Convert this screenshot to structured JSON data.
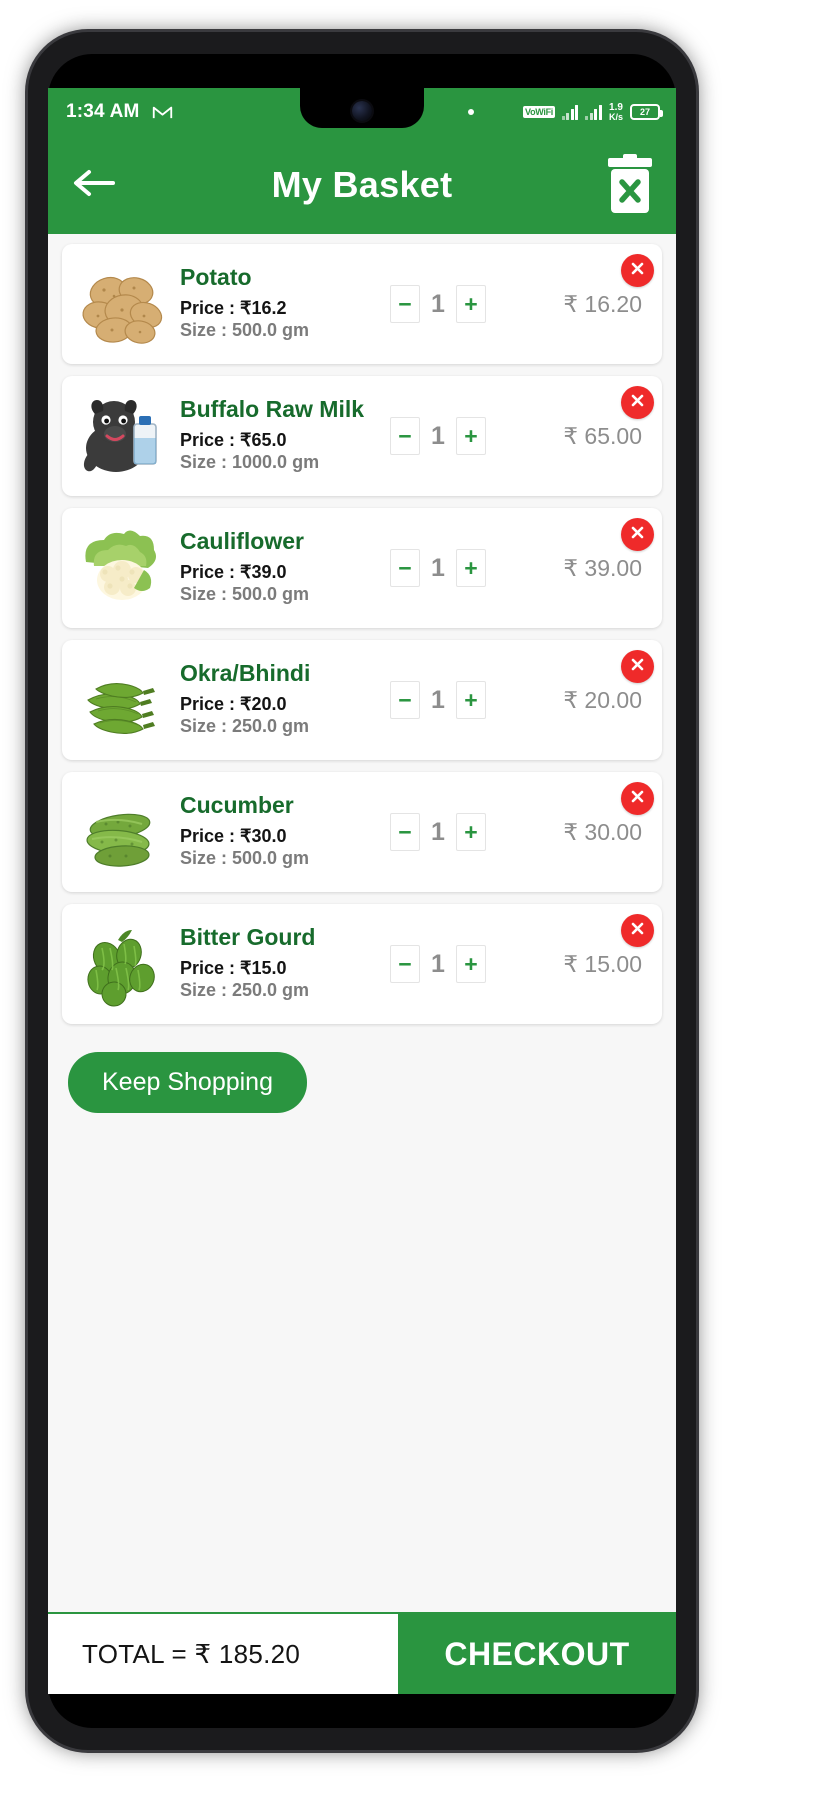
{
  "status_bar": {
    "clock": "1:34 AM",
    "mail_icon": "gmail-icon",
    "dot_icon": "notification-dot-icon",
    "vowifi_label": "VoWiFi",
    "data_speed_value": "1.9",
    "data_speed_unit": "K/s",
    "battery_percent": "27"
  },
  "app_bar": {
    "back_icon": "back-arrow-icon",
    "title": "My Basket",
    "clear_cart_icon": "trash-delete-icon"
  },
  "colors": {
    "brand_green": "#2a9540",
    "title_green": "#176b2c",
    "delete_red": "#ef2a2a",
    "muted_gray": "#8d8d8d",
    "page_bg": "#f7f7f7"
  },
  "stepper": {
    "decrement_label": "−",
    "increment_label": "+"
  },
  "labels": {
    "price_prefix": "Price : ",
    "size_prefix": "Size : ",
    "rupee": "₹"
  },
  "cart_items": [
    {
      "name": "Potato",
      "icon": "potato-image",
      "price": "Price : ₹16.2",
      "size": "Size : 500.0 gm",
      "qty": "1",
      "line_total": "₹ 16.20",
      "delete_icon": "remove-item-icon"
    },
    {
      "name": "Buffalo Raw Milk",
      "icon": "buffalo-milk-image",
      "price": "Price : ₹65.0",
      "size": "Size : 1000.0 gm",
      "qty": "1",
      "line_total": "₹ 65.00",
      "delete_icon": "remove-item-icon"
    },
    {
      "name": "Cauliflower",
      "icon": "cauliflower-image",
      "price": "Price : ₹39.0",
      "size": "Size : 500.0 gm",
      "qty": "1",
      "line_total": "₹ 39.00",
      "delete_icon": "remove-item-icon"
    },
    {
      "name": "Okra/Bhindi",
      "icon": "okra-image",
      "price": "Price : ₹20.0",
      "size": "Size : 250.0 gm",
      "qty": "1",
      "line_total": "₹ 20.00",
      "delete_icon": "remove-item-icon"
    },
    {
      "name": "Cucumber",
      "icon": "cucumber-image",
      "price": "Price : ₹30.0",
      "size": "Size : 500.0 gm",
      "qty": "1",
      "line_total": "₹ 30.00",
      "delete_icon": "remove-item-icon"
    },
    {
      "name": "Bitter Gourd",
      "icon": "bitter-gourd-image",
      "price": "Price : ₹15.0",
      "size": "Size : 250.0 gm",
      "qty": "1",
      "line_total": "₹ 15.00",
      "delete_icon": "remove-item-icon"
    }
  ],
  "keep_shopping_label": "Keep Shopping",
  "bottom_bar": {
    "total_label": "TOTAL =  ₹ 185.20",
    "checkout_label": "CHECKOUT"
  }
}
